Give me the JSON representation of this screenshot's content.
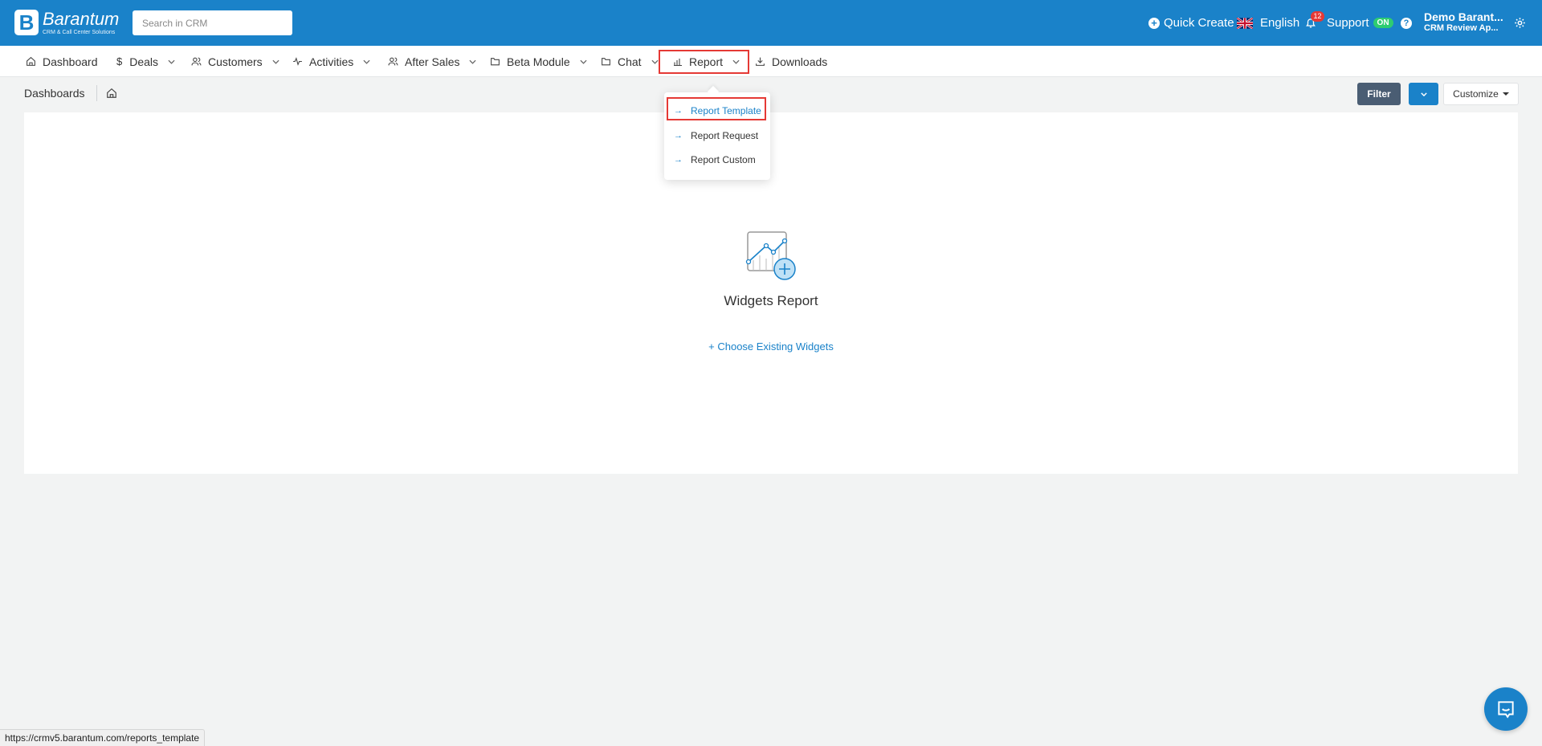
{
  "topbar": {
    "logo_mark": "B",
    "logo_name": "Barantum",
    "logo_sub": "CRM & Call Center Solutions",
    "search_placeholder": "Search in CRM",
    "quick_create": "Quick Create",
    "language": "English",
    "notification_count": "12",
    "support": "Support",
    "support_status": "ON",
    "user_name": "Demo Barant...",
    "user_role": "CRM Review Ap..."
  },
  "nav": {
    "dashboard": "Dashboard",
    "deals": "Deals",
    "customers": "Customers",
    "activities": "Activities",
    "after_sales": "After Sales",
    "beta_module": "Beta Module",
    "chat": "Chat",
    "report": "Report",
    "downloads": "Downloads"
  },
  "report_menu": {
    "items": [
      {
        "label": "Report Template"
      },
      {
        "label": "Report Request"
      },
      {
        "label": "Report Custom"
      }
    ]
  },
  "subheader": {
    "breadcrumb": "Dashboards",
    "filter": "Filter",
    "customize": "Customize"
  },
  "content": {
    "title": "Widgets Report",
    "choose_link": "+ Choose Existing Widgets"
  },
  "status_url": "https://crmv5.barantum.com/reports_template",
  "colors": {
    "brand": "#1a82c9",
    "highlight": "#e53935",
    "filter_button": "#4a5d73",
    "on_badge": "#2ecc71"
  }
}
